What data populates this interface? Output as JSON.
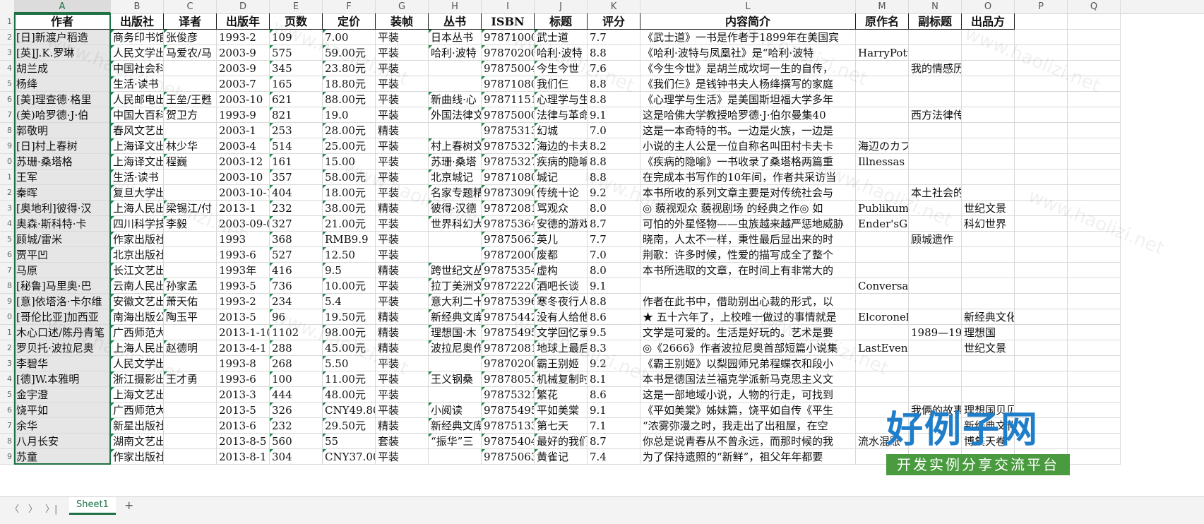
{
  "columns": [
    "A",
    "B",
    "C",
    "D",
    "E",
    "F",
    "G",
    "H",
    "I",
    "J",
    "K",
    "L",
    "M",
    "N",
    "O",
    "P",
    "Q"
  ],
  "selected_column": "A",
  "headers": [
    "作者",
    "出版社",
    "译者",
    "出版年",
    "页数",
    "定价",
    "装帧",
    "丛书",
    "ISBN",
    "标题",
    "评分",
    "内容简介",
    "原作名",
    "副标题",
    "出品方",
    "",
    ""
  ],
  "row_numbers": [
    "1",
    "2",
    "3",
    "4",
    "5",
    "6",
    "7",
    "8",
    "9",
    "0",
    "1",
    "2",
    "3",
    "4",
    "5",
    "6",
    "7",
    "8",
    "9",
    "0",
    "1",
    "2",
    "3",
    "4",
    "5",
    "6",
    "7",
    "8",
    "9"
  ],
  "rows": [
    [
      "[日]新渡户稻造",
      "商务印书馆",
      "张俊彦",
      "1993-2",
      "109",
      "7.00",
      "平装",
      "日本丛书",
      "978710001",
      "武士道",
      "7.7",
      "《武士道》一书是作者于1899年在美国宾",
      "",
      "",
      ""
    ],
    [
      "[英]J.K.罗琳",
      "人民文学出",
      "马爱农/马",
      "2003-9",
      "575",
      "59.00元",
      "平装",
      "哈利·波特",
      "978702004",
      "哈利·波特",
      "8.8",
      "《哈利·波特与凤凰社》是“哈利·波特",
      "HarryPott",
      "",
      ""
    ],
    [
      "胡兰成",
      "中国社会科",
      "",
      "2003-9",
      "345",
      "23.80元",
      "平装",
      "",
      "978750043",
      "今生今世",
      "7.6",
      "《今生今世》是胡兰成坎坷一生的自传，",
      "",
      "我的情感历",
      ""
    ],
    [
      "杨绛",
      "生活·读书",
      "",
      "2003-7",
      "165",
      "18.80元",
      "平装",
      "",
      "978710801",
      "我们仨",
      "8.8",
      "《我们仨》是钱钟书夫人杨绛撰写的家庭",
      "",
      "",
      ""
    ],
    [
      "[美]理查德·格里",
      "人民邮电出",
      "王垒/王甦",
      "2003-10",
      "621",
      "88.00元",
      "平装",
      "新曲线·心",
      "978711511",
      "心理学与生",
      "8.8",
      "《心理学与生活》是美国斯坦福大学多年",
      "",
      "",
      ""
    ],
    [
      "(美)哈罗德·J·伯",
      "中国大百科",
      "贺卫方",
      "1993-9",
      "821",
      "19.0",
      "平装",
      "外国法律文",
      "978750005",
      "法律与革命",
      "9.1",
      "这是哈佛大学教授哈罗德·J·伯尔曼集40",
      "",
      "西方法律传",
      ""
    ],
    [
      "郭敬明",
      "春风文艺出",
      "",
      "2003-1",
      "253",
      "28.00元",
      "精装",
      "",
      "978753132",
      "幻城",
      "7.0",
      "这是一本奇特的书。一边是火族，一边是",
      "",
      "",
      ""
    ],
    [
      "[日]村上春树",
      "上海译文出",
      "林少华",
      "2003-4",
      "514",
      "25.00元",
      "平装",
      "村上春树文",
      "978753273",
      "海边的卡夫",
      "8.2",
      "小说的主人公是一位自称名叫田村卡夫卡",
      "海辺のカフ",
      "",
      ""
    ],
    [
      "苏珊·桑塔格",
      "上海译文出",
      "程巍",
      "2003-12",
      "161",
      "15.00",
      "平装",
      "苏珊·桑塔",
      "978753273",
      "疾病的隐喻",
      "8.8",
      "《疾病的隐喻》一书收录了桑塔格两篇重",
      "Illnessas",
      "",
      ""
    ],
    [
      "王军",
      "生活·读书",
      "",
      "2003-10",
      "357",
      "58.00元",
      "平装",
      "北京城记",
      "978710801",
      "城记",
      "8.8",
      "在完成本书写作的10年间，作者共采访当",
      "",
      "",
      ""
    ],
    [
      "秦晖",
      "复旦大学出",
      "",
      "2003-10-1",
      "404",
      "18.00元",
      "平装",
      "名家专题精",
      "978730903",
      "传统十论",
      "9.2",
      "本书所收的系列文章主要是对传统社会与",
      "",
      "本土社会的",
      ""
    ],
    [
      "[奥地利]彼得·汉",
      "上海人民出",
      "梁锡江/付",
      "2013-1",
      "232",
      "38.00元",
      "精装",
      "彼得·汉德",
      "978720810",
      "骂观众",
      "8.0",
      "◎ 藐视观众 藐视剧场 的经典之作◎ 如",
      "Publikums",
      "",
      "世纪文景"
    ],
    [
      "奥森·斯科特·卡",
      "四川科学技",
      "李毅",
      "2003-09-0",
      "327",
      "21.00元",
      "平装",
      "世界科幻大",
      "978753645",
      "安德的游戏",
      "8.7",
      "可怕的外星怪物——虫族越来越严惩地威胁",
      "Ender'sGa",
      "",
      "科幻世界"
    ],
    [
      "顾城/雷米",
      "作家出版社",
      "",
      "1993",
      "368",
      "RMB9.9",
      "平装",
      "",
      "978750630",
      "英儿",
      "7.7",
      "晓南，人太不一样，秉性最后显出来的时",
      "",
      "顾城遗作",
      ""
    ],
    [
      "贾平凹",
      "北京出版社",
      "",
      "1993-6",
      "527",
      "12.50",
      "平装",
      "",
      "978720001",
      "废都",
      "7.0",
      "荆歌：许多时候，性爱的描写成全了整个",
      "",
      "",
      ""
    ],
    [
      "马原",
      "长江文艺出",
      "",
      "1993年",
      "416",
      "9.5",
      "精装",
      "跨世纪文丛",
      "978753541",
      "虚构",
      "8.0",
      "本书所选取的文章，在时间上有非常大的",
      "",
      "",
      ""
    ],
    [
      "[秘鲁]马里奥·巴",
      "云南人民出",
      "孙家孟",
      "1993-5",
      "736",
      "10.00元",
      "平装",
      "拉丁美洲文",
      "978722201",
      "酒吧长谈",
      "9.1",
      "",
      "Conversac",
      "",
      ""
    ],
    [
      "[意]依塔洛·卡尔维",
      "安徽文艺出",
      "萧天佑",
      "1993-2",
      "234",
      "5.4",
      "平装",
      "意大利二十",
      "978753960",
      "寒冬夜行人",
      "8.8",
      "作者在此书中，借助别出心裁的形式，以",
      "",
      "",
      ""
    ],
    [
      "[哥伦比亚]加西亚",
      "南海出版公",
      "陶玉平",
      "2013-5",
      "96",
      "19.50元",
      "精装",
      "新经典文库",
      "978754426",
      "没有人给他",
      "8.6",
      "★ 五十六年了，上校唯一做过的事情就是",
      "Elcoronel",
      "",
      "新经典文化"
    ],
    [
      "木心口述/陈丹青笔",
      "广西师范大",
      "",
      "2013-1-10",
      "1102",
      "98.00元",
      "精装",
      "理想国·木",
      "978754953",
      "文学回忆录",
      "9.5",
      "文学是可爱的。生活是好玩的。艺术是要",
      "",
      "1989—199",
      "理想国"
    ],
    [
      "罗贝托·波拉尼奥",
      "上海人民出",
      "赵德明",
      "2013-4-1",
      "288",
      "45.00元",
      "精装",
      "波拉尼奥作",
      "978720811",
      "地球上最后",
      "8.3",
      "◎《2666》作者波拉尼奥首部短篇小说集",
      "LastEveni",
      "",
      "世纪文景"
    ],
    [
      "李碧华",
      "人民文学出",
      "",
      "1993-8",
      "268",
      "5.50",
      "平装",
      "",
      "978702001",
      "霸王别姬",
      "9.2",
      "《霸王别姬》以梨园师兄弟程蝶衣和段小",
      "",
      "",
      ""
    ],
    [
      "[德]W.本雅明",
      "浙江摄影出",
      "王才勇",
      "1993-6",
      "100",
      "11.00元",
      "平装",
      "王义钢桑",
      "978780536",
      "机械复制时",
      "8.1",
      "本书是德国法兰福克学派新马克思主义文",
      "",
      "",
      ""
    ],
    [
      "金宇澄",
      "上海文艺出",
      "",
      "2013-3",
      "444",
      "48.00元",
      "平装",
      "",
      "978753214",
      "繁花",
      "8.6",
      "这是一部地域小说，人物的行走，可找到",
      "",
      "",
      ""
    ],
    [
      "饶平如",
      "广西师范大",
      "",
      "2013-5",
      "326",
      "CNY49.80",
      "平装",
      "小阅读",
      "978754953",
      "平如美棠",
      "9.1",
      "《平如美棠》姊妹篇，饶平如自传《平生",
      "",
      "我俩的故事",
      "理想国贝贝特"
    ],
    [
      "余华",
      "新星出版社",
      "",
      "2013-6",
      "232",
      "29.50元",
      "精装",
      "新经典文库",
      "978751331",
      "第七天",
      "7.1",
      "“浓雾弥漫之时，我走出了出租屋，在空",
      "",
      "",
      "新经典文化"
    ],
    [
      "八月长安",
      "湖南文艺出",
      "",
      "2013-8-5",
      "560",
      "55",
      "套装",
      "“振华”三",
      "978754046",
      "最好的我们",
      "8.7",
      "你总是说青春从不曾永远，而那时候的我",
      "流水混账",
      "",
      "博集天卷"
    ],
    [
      "苏童",
      "作家出版社",
      "",
      "2013-8-1",
      "304",
      "CNY37.00",
      "平装",
      "",
      "978750636",
      "黄雀记",
      "7.4",
      "为了保持遗照的“新鲜”，祖父年年都要",
      "",
      "",
      ""
    ]
  ],
  "watermark_text": "www.haolizi.net",
  "logo": {
    "title": "好例子网",
    "subtitle": "开发实例分享交流平台"
  },
  "tabs": {
    "nav_prev": "〈",
    "nav_next": "〉",
    "nav_last": "〉|",
    "sheet": "Sheet1",
    "add": "+"
  }
}
